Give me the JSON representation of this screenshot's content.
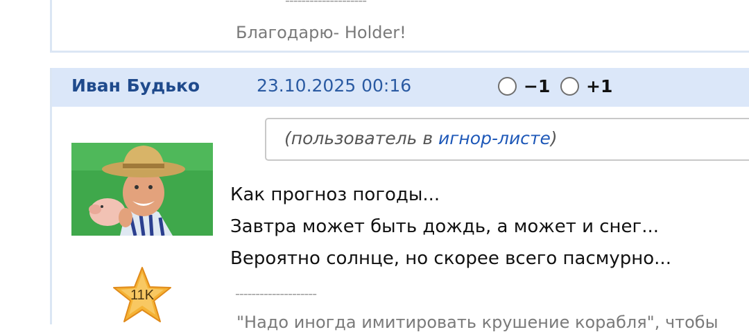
{
  "prev_post": {
    "signature_separator": "--------------------",
    "signature_text": "Благодарю- Holder!"
  },
  "post": {
    "author": "Иван Будько",
    "date": "23.10.2025 00:16",
    "vote_minus_label": "−1",
    "vote_plus_label": "+1",
    "ignore_notice": {
      "prefix": "(пользователь в ",
      "link": "игнор-листе",
      "suffix": ")"
    },
    "body_lines": [
      "Как прогноз погоды...",
      "Завтра может быть дождь, а может и снег...",
      "Вероятно солнце, но скорее всего пасмурно..."
    ],
    "signature_separator": "--------------------",
    "signature_text": "\"Надо иногда имитировать крушение корабля\", чтобы",
    "rank_badge": "11K"
  },
  "colors": {
    "header_bg": "#dbe7f9",
    "author": "#1f4a8c",
    "date": "#2a5aa2",
    "link": "#1e58b8",
    "star": "#f5b335"
  },
  "icons": {
    "rank": "star-icon",
    "avatar": "user-avatar"
  }
}
